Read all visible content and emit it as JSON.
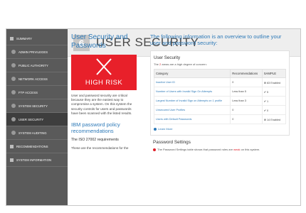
{
  "sidebar": {
    "items": [
      {
        "label": "Summary",
        "style": "square"
      },
      {
        "label": "Admin Privileges",
        "style": "bullet"
      },
      {
        "label": "Public Authority",
        "style": "bullet"
      },
      {
        "label": "Network Access",
        "style": "bullet"
      },
      {
        "label": "FTP Access",
        "style": "bullet"
      },
      {
        "label": "System Security",
        "style": "bullet"
      },
      {
        "label": "User Security",
        "style": "bullet",
        "active": true
      },
      {
        "label": "System Auditing",
        "style": "bullet"
      },
      {
        "label": "Recommendations",
        "style": "square"
      },
      {
        "label": "System Information",
        "style": "square"
      }
    ]
  },
  "header": {
    "number": "6",
    "title": "USER SECURITY"
  },
  "left": {
    "heading": "User Security and Passwords",
    "risk_label": "HIGH RISK",
    "description": "User and password security are critical because they are the easiest way to compromise a system. On this system the security controls for users and passwords have been scanned with the listed results.",
    "ibm_heading": "IBM password policy recommendations",
    "iso_line": "The ISO 27002 requirements",
    "recs_line": "These are the recommendations for the"
  },
  "right": {
    "intro": "The following information is an overview to outline your user and password security:",
    "panel_title": "User Security",
    "panel_sub_prefix": "The ",
    "panel_sub_count": "2",
    "panel_sub_suffix": " areas are a high degree of concern:",
    "table": {
      "headers": [
        "Category",
        "Recommendations",
        "SAMPLE"
      ],
      "rows": [
        {
          "category": "Inactive User ID",
          "rec": "0",
          "status": "63 Enabled",
          "state": "bad"
        },
        {
          "category": "Number of Users with Invalid Sign On Attempts",
          "rec": "Less than 5",
          "status": "5",
          "state": "ok"
        },
        {
          "category": "Largest Number of Invalid Sign on Attempts on 1 profile",
          "rec": "Less than 3",
          "status": "1",
          "state": "ok"
        },
        {
          "category": "Unsecured User Profiles",
          "rec": "0",
          "status": "0",
          "state": "ok"
        },
        {
          "category": "Users with Default Passwords",
          "rec": "0",
          "status": "14 Enabled",
          "state": "bad"
        }
      ]
    },
    "learn_more": "Learn More",
    "pw_title": "Password Settings",
    "pw_text_prefix": "The Password Settings table shows that password rules are ",
    "pw_text_weak": "weak",
    "pw_text_suffix": " on this system."
  },
  "colors": {
    "accent": "#2e7ab8",
    "risk": "#e8202a",
    "sidebar": "#5a5a5a"
  }
}
